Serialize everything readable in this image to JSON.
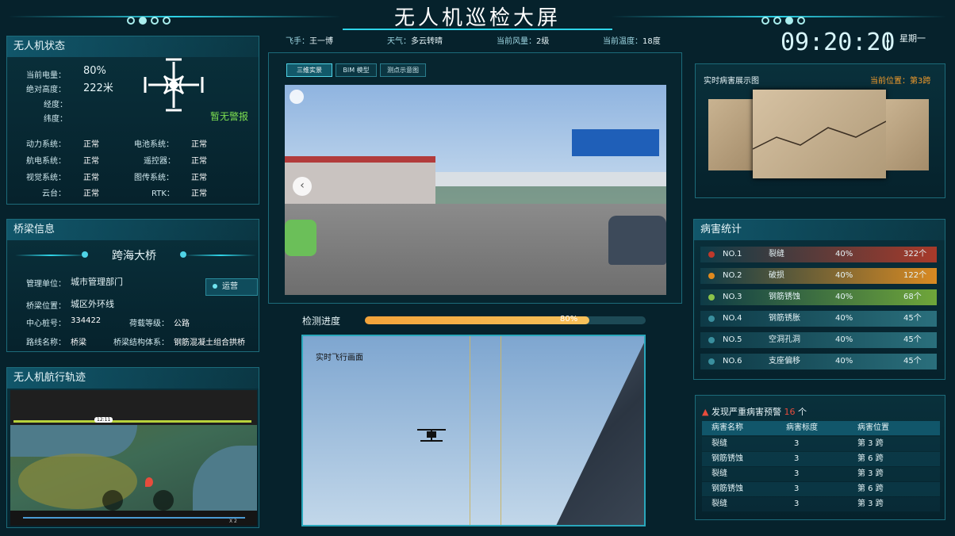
{
  "header": {
    "title": "无人机巡检大屏",
    "pilot_label": "飞手：",
    "pilot": "王一博",
    "weather_label": "天气：",
    "weather": "多云转晴",
    "wind_label": "当前风量：",
    "wind": "2级",
    "temp_label": "当前温度：",
    "temp": "18度",
    "time": "09:20:20",
    "weekday": "星期一"
  },
  "drone_status": {
    "title": "无人机状态",
    "battery_label": "当前电量：",
    "battery": "80%",
    "altitude_label": "绝对高度：",
    "altitude": "222米",
    "longitude_label": "经度：",
    "latitude_label": "纬度：",
    "alarm": "暂无警报",
    "systems": [
      {
        "label": "动力系统：",
        "value": "正常"
      },
      {
        "label": "电池系统：",
        "value": "正常"
      },
      {
        "label": "航电系统：",
        "value": "正常"
      },
      {
        "label": "遥控器：",
        "value": "正常"
      },
      {
        "label": "视觉系统：",
        "value": "正常"
      },
      {
        "label": "图传系统：",
        "value": "正常"
      },
      {
        "label": "云台：",
        "value": "正常"
      },
      {
        "label": "RTK：",
        "value": "正常"
      }
    ]
  },
  "bridge": {
    "title": "桥梁信息",
    "name": "跨海大桥",
    "unit_label": "管理单位：",
    "unit": "城市管理部门",
    "status": "运营",
    "location_label": "桥梁位置：",
    "location": "城区外环线",
    "pile_label": "中心桩号：",
    "pile": "334422",
    "load_label": "荷载等级：",
    "load": "公路",
    "route_label": "路线名称：",
    "route": "桥梁",
    "structure_label": "桥梁结构体系：",
    "structure": "钢筋混凝土组合拱桥"
  },
  "track": {
    "title": "无人机航行轨迹",
    "speed_label": "X 2",
    "scrub_time": "12:11"
  },
  "center": {
    "tabs": [
      "三维实景",
      "BIM 模型",
      "测点示意图"
    ],
    "progress_label": "检测进度",
    "progress_text": "80%",
    "progress": 0.8,
    "live_label": "实时飞行画面"
  },
  "damage_show": {
    "title": "实时病害展示图",
    "position": "当前位置：第3跨"
  },
  "stats": {
    "title": "病害统计",
    "rows": [
      {
        "no": "NO.1",
        "name": "裂缝",
        "pct": "40%",
        "count": "322个",
        "color": "#c0392b",
        "bar": "#a83a2a"
      },
      {
        "no": "NO.2",
        "name": "破损",
        "pct": "40%",
        "count": "122个",
        "color": "#e08a1e",
        "bar": "#d98a22"
      },
      {
        "no": "NO.3",
        "name": "钢筋锈蚀",
        "pct": "40%",
        "count": "68个",
        "color": "#8bc34a",
        "bar": "#6fa63a"
      },
      {
        "no": "NO.4",
        "name": "钢筋锈胀",
        "pct": "40%",
        "count": "45个",
        "color": "#3a8f9e",
        "bar": "#2a6f7c"
      },
      {
        "no": "NO.5",
        "name": "空洞孔洞",
        "pct": "40%",
        "count": "45个",
        "color": "#3a8f9e",
        "bar": "#2a6f7c"
      },
      {
        "no": "NO.6",
        "name": "支座偏移",
        "pct": "40%",
        "count": "45个",
        "color": "#3a8f9e",
        "bar": "#2a6f7c"
      }
    ]
  },
  "warning": {
    "title": "发现严重病害预警",
    "count": "16",
    "unit": "个",
    "headers": [
      "病害名称",
      "病害标度",
      "病害位置"
    ],
    "rows": [
      [
        "裂缝",
        "3",
        "第 3 跨"
      ],
      [
        "钢筋锈蚀",
        "3",
        "第 6 跨"
      ],
      [
        "裂缝",
        "3",
        "第 3 跨"
      ],
      [
        "钢筋锈蚀",
        "3",
        "第 6 跨"
      ],
      [
        "裂缝",
        "3",
        "第 3 跨"
      ]
    ]
  }
}
